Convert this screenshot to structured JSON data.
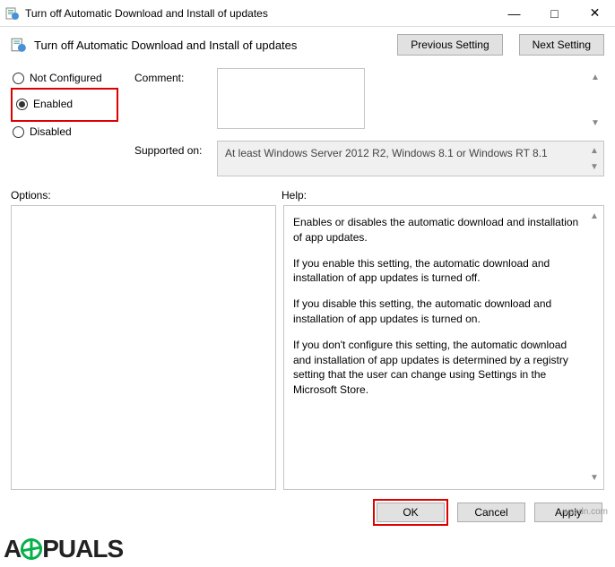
{
  "window": {
    "title": "Turn off Automatic Download and Install of updates"
  },
  "header": {
    "policy_title": "Turn off Automatic Download and Install of updates",
    "prev_btn": "Previous Setting",
    "next_btn": "Next Setting"
  },
  "state": {
    "not_configured": "Not Configured",
    "enabled": "Enabled",
    "disabled": "Disabled"
  },
  "fields": {
    "comment_label": "Comment:",
    "comment_value": "",
    "supported_label": "Supported on:",
    "supported_value": "At least Windows Server 2012 R2, Windows 8.1 or Windows RT 8.1"
  },
  "labels": {
    "options": "Options:",
    "help": "Help:"
  },
  "help": {
    "p1": "Enables or disables the automatic download and installation of app updates.",
    "p2": "If you enable this setting, the automatic download and installation of app updates is turned off.",
    "p3": "If you disable this setting, the automatic download and installation of app updates is turned on.",
    "p4": "If you don't configure this setting, the automatic download and installation of app updates is determined by a registry setting that the user can change using Settings in the Microsoft Store."
  },
  "footer": {
    "ok": "OK",
    "cancel": "Cancel",
    "apply": "Apply"
  },
  "credit": "wsxdn.com"
}
